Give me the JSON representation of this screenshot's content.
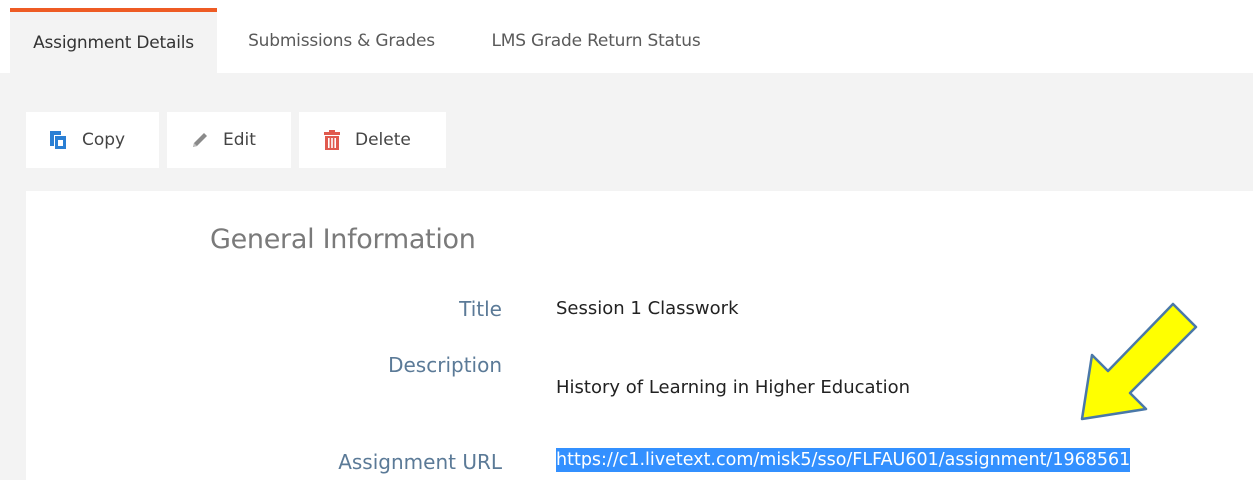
{
  "tabs": [
    {
      "label": "Assignment Details",
      "active": true
    },
    {
      "label": "Submissions & Grades",
      "active": false
    },
    {
      "label": "LMS Grade Return Status",
      "active": false
    }
  ],
  "toolbar": {
    "copy_label": "Copy",
    "edit_label": "Edit",
    "delete_label": "Delete"
  },
  "details": {
    "section_title": "General Information",
    "title_label": "Title",
    "title_value": "Session 1 Classwork",
    "description_label": "Description",
    "description_value": "History of Learning in Higher Education",
    "url_label": "Assignment URL",
    "url_value": "https://c1.livetext.com/misk5/sso/FLFAU601/assignment/1968561"
  },
  "colors": {
    "accent": "#ee5b24",
    "label": "#5b7a97",
    "selection": "#3390ff",
    "copy_icon": "#2a7fd4",
    "delete_icon": "#e05a4e",
    "arrow": "#ffff00"
  },
  "icons": {
    "copy": "copy-icon",
    "edit": "pencil-icon",
    "delete": "trash-icon",
    "annotation": "arrow-icon"
  }
}
